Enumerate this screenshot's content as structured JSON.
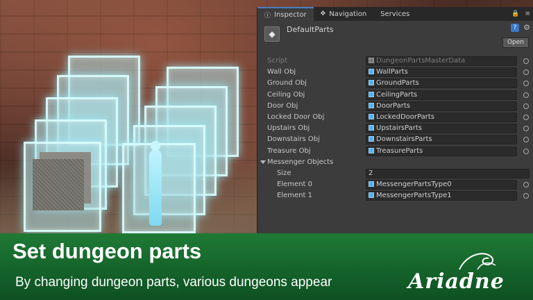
{
  "tabs": [
    {
      "label": "Inspector",
      "icon": "info-icon"
    },
    {
      "label": "Navigation",
      "icon": "navigation-icon"
    },
    {
      "label": "Services"
    }
  ],
  "object": {
    "name": "DefaultParts",
    "open_label": "Open"
  },
  "fields": [
    {
      "label": "Script",
      "value": "DungeonPartsMasterData",
      "dim": true
    },
    {
      "label": "Wall Obj",
      "value": "WallParts"
    },
    {
      "label": "Ground Obj",
      "value": "GroundParts"
    },
    {
      "label": "Ceiling Obj",
      "value": "CeilingParts"
    },
    {
      "label": "Door Obj",
      "value": "DoorParts"
    },
    {
      "label": "Locked Door Obj",
      "value": "LockedDoorParts"
    },
    {
      "label": "Upstairs Obj",
      "value": "UpstairsParts"
    },
    {
      "label": "Downstairs Obj",
      "value": "DownstairsParts"
    },
    {
      "label": "Treasure Obj",
      "value": "TreasureParts"
    }
  ],
  "messenger": {
    "label": "Messenger Objects",
    "size_label": "Size",
    "size_value": "2",
    "elements": [
      {
        "label": "Element 0",
        "value": "MessengerPartsType0"
      },
      {
        "label": "Element 1",
        "value": "MessengerPartsType1"
      }
    ]
  },
  "banner": {
    "title": "Set dungeon parts",
    "subtitle": "By changing dungeon parts, various dungeons appear",
    "logo": "Ariadne"
  },
  "colors": {
    "banner": "#1f7a35",
    "panel_glow": "#a0f0ff",
    "tab_accent": "#4a7fc1"
  }
}
